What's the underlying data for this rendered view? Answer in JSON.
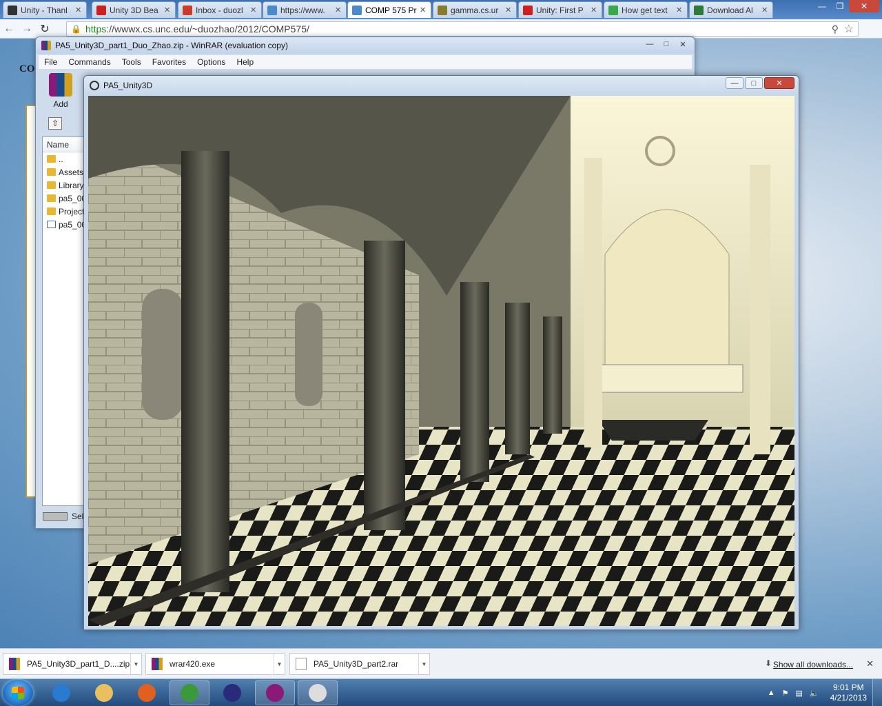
{
  "browser": {
    "tabs": [
      {
        "label": "Unity - Thanl",
        "icon": "unity-icon",
        "color": "#333333",
        "active": false
      },
      {
        "label": "Unity 3D Bea",
        "icon": "youtube-icon",
        "color": "#cc2020",
        "active": false
      },
      {
        "label": "Inbox - duozl",
        "icon": "gmail-icon",
        "color": "#cc3a2a",
        "active": false
      },
      {
        "label": "https://www.",
        "icon": "unc-icon",
        "color": "#4a8ac8",
        "active": false
      },
      {
        "label": "COMP 575 Pr",
        "icon": "unc-icon",
        "color": "#4a8ac8",
        "active": true
      },
      {
        "label": "gamma.cs.ur",
        "icon": "gamma-icon",
        "color": "#8a7a30",
        "active": false
      },
      {
        "label": "Unity: First P",
        "icon": "youtube-icon",
        "color": "#cc2020",
        "active": false
      },
      {
        "label": "How get text",
        "icon": "unity-answers-icon",
        "color": "#3aa84a",
        "active": false
      },
      {
        "label": "Download Al",
        "icon": "download-site-icon",
        "color": "#2a7a3a",
        "active": false
      }
    ],
    "url_scheme": "https",
    "url_rest": "://wwwx.cs.unc.edu/~duozhao/2012/COMP575/"
  },
  "page": {
    "heading": "CO"
  },
  "winrar": {
    "title": "PA5_Unity3D_part1_Duo_Zhao.zip - WinRAR (evaluation copy)",
    "menu": [
      "File",
      "Commands",
      "Tools",
      "Favorites",
      "Options",
      "Help"
    ],
    "add_label": "Add",
    "column_name": "Name",
    "files": [
      {
        "name": "..",
        "type": "folder"
      },
      {
        "name": "Assets",
        "type": "folder"
      },
      {
        "name": "Library",
        "type": "folder"
      },
      {
        "name": "pa5_00",
        "type": "folder"
      },
      {
        "name": "Project",
        "type": "folder"
      },
      {
        "name": "pa5_00",
        "type": "file"
      }
    ],
    "status": "Sel"
  },
  "unity": {
    "title": "PA5_Unity3D"
  },
  "downloads": {
    "items": [
      {
        "name": "PA5_Unity3D_part1_D....zip",
        "icon": "winrar-archive-icon"
      },
      {
        "name": "wrar420.exe",
        "icon": "winrar-installer-icon"
      },
      {
        "name": "PA5_Unity3D_part2.rar",
        "icon": "file-icon"
      }
    ],
    "show_all": "Show all downloads..."
  },
  "taskbar": {
    "apps": [
      {
        "name": "internet-explorer-icon",
        "color": "#2a7ad0",
        "running": false
      },
      {
        "name": "file-explorer-icon",
        "color": "#e8c060",
        "running": false
      },
      {
        "name": "firefox-icon",
        "color": "#e06020",
        "running": false
      },
      {
        "name": "chrome-icon",
        "color": "#3a9a3a",
        "running": true
      },
      {
        "name": "eclipse-icon",
        "color": "#2a2a7a",
        "running": false
      },
      {
        "name": "winrar-icon",
        "color": "#8a1a7a",
        "running": true
      },
      {
        "name": "unity-icon",
        "color": "#dddddd",
        "running": true
      }
    ],
    "time": "9:01 PM",
    "date": "4/21/2013"
  }
}
